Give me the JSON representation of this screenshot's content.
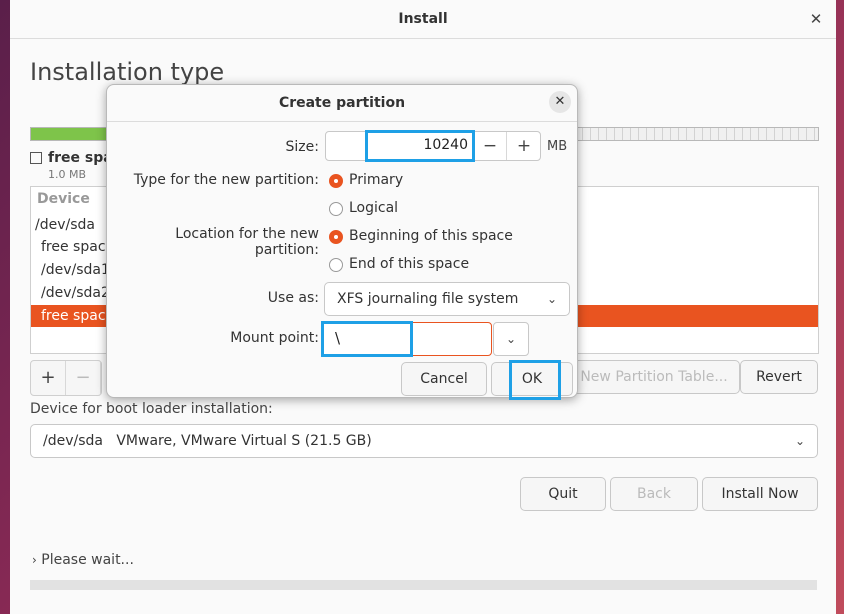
{
  "window": {
    "title": "Install"
  },
  "page": {
    "heading": "Installation type"
  },
  "disk_bar": {
    "legend_name": "free spa",
    "legend_size": "1.0 MB"
  },
  "table": {
    "header": "Device",
    "rows": [
      {
        "label": "/dev/sda",
        "selected": false
      },
      {
        "label": "free space",
        "selected": false
      },
      {
        "label": "/dev/sda1",
        "selected": false
      },
      {
        "label": "/dev/sda2",
        "selected": false
      },
      {
        "label": "free space",
        "selected": true
      }
    ]
  },
  "toolbar": {
    "add": "+",
    "remove": "−"
  },
  "buttons": {
    "new_partition_table": "New Partition Table...",
    "revert": "Revert",
    "quit": "Quit",
    "back": "Back",
    "install_now": "Install Now"
  },
  "boot_loader": {
    "label": "Device for boot loader installation:",
    "device": "/dev/sda",
    "description": "VMware, VMware Virtual S (21.5 GB)"
  },
  "status": {
    "text": "Please wait..."
  },
  "dialog": {
    "title": "Create partition",
    "size_label": "Size:",
    "size_value": "10240",
    "size_unit": "MB",
    "minus": "−",
    "plus": "+",
    "type_label": "Type for the new partition:",
    "type_options": [
      {
        "label": "Primary",
        "selected": true
      },
      {
        "label": "Logical",
        "selected": false
      }
    ],
    "location_label": "Location for the new partition:",
    "location_options": [
      {
        "label": "Beginning of this space",
        "selected": true
      },
      {
        "label": "End of this space",
        "selected": false
      }
    ],
    "use_as_label": "Use as:",
    "use_as_value": "XFS journaling file system",
    "mount_label": "Mount point:",
    "mount_value": "\\",
    "cancel": "Cancel",
    "ok": "OK"
  },
  "colors": {
    "accent": "#e95420",
    "used": "#7ec44a",
    "highlight": "#1ea0e6"
  }
}
